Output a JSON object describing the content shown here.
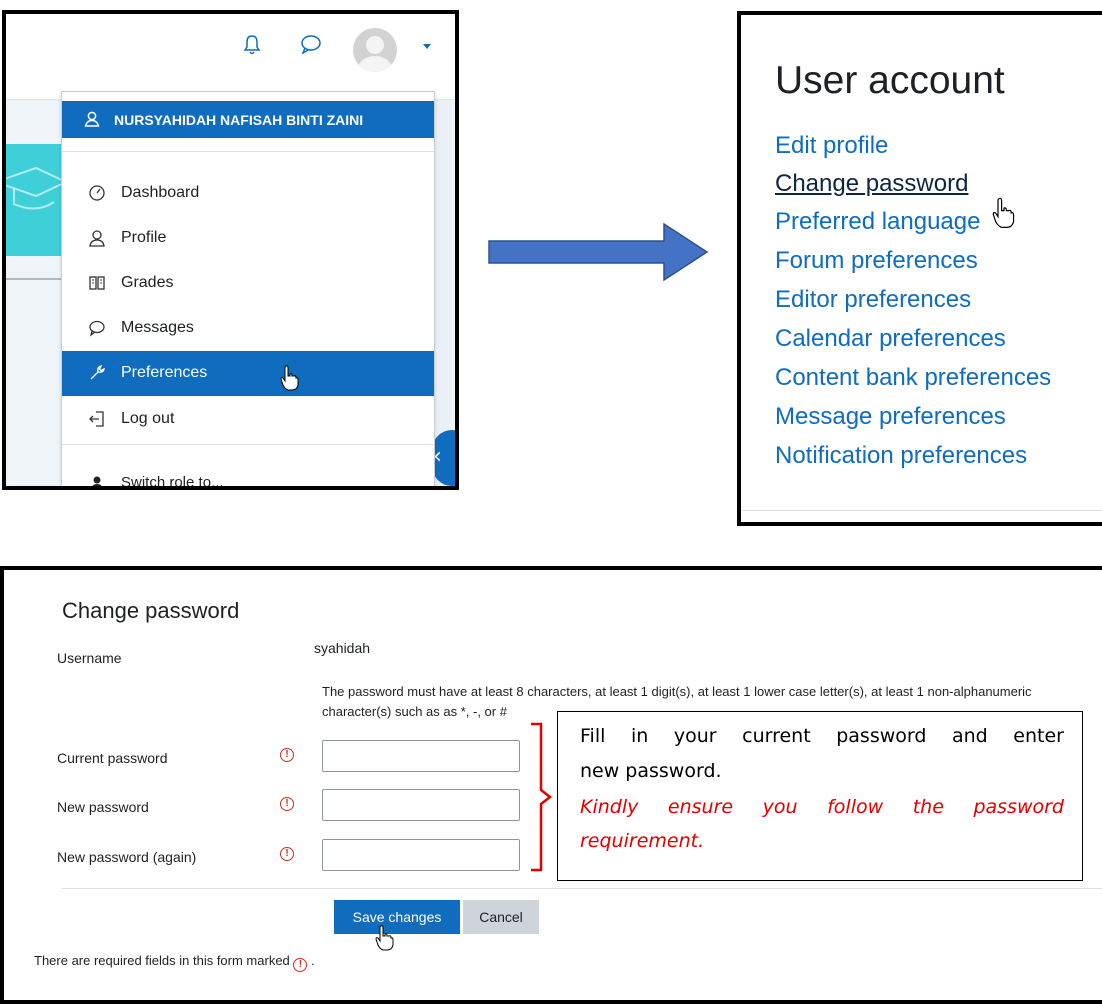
{
  "panel1": {
    "user_name": "NURSYAHIDAH NAFISAH BINTI ZAINI",
    "menu_items": [
      {
        "label": "Dashboard",
        "icon": "dashboard-icon"
      },
      {
        "label": "Profile",
        "icon": "user-icon"
      },
      {
        "label": "Grades",
        "icon": "grades-icon"
      },
      {
        "label": "Messages",
        "icon": "message-icon"
      },
      {
        "label": "Preferences",
        "icon": "wrench-icon",
        "active": true
      },
      {
        "label": "Log out",
        "icon": "logout-icon"
      },
      {
        "label": "Switch role to...",
        "icon": "role-icon"
      }
    ]
  },
  "panel2": {
    "title": "User account",
    "links": [
      "Edit profile",
      "Change password",
      "Preferred language",
      "Forum preferences",
      "Editor preferences",
      "Calendar preferences",
      "Content bank preferences",
      "Message preferences",
      "Notification preferences"
    ]
  },
  "panel3": {
    "title": "Change password",
    "username_label": "Username",
    "username_value": "syahidah",
    "password_rules": "The password must have at least 8 characters, at least 1 digit(s), at least 1 lower case letter(s), at least 1 non-alphanumeric character(s) such as as *, -, or #",
    "fields": [
      "Current password",
      "New password",
      "New password (again)"
    ],
    "save_label": "Save changes",
    "cancel_label": "Cancel",
    "required_note": "There are required fields in this form marked",
    "required_note_end": " .",
    "required_mark": "!"
  },
  "callout": {
    "line1": "Fill in your current password and enter",
    "line2": "new password.",
    "line3": "Kindly ensure you follow the password",
    "line4": "requirement."
  },
  "colors": {
    "primary": "#0f6cbf",
    "required": "#ca3120",
    "callout_emphasis": "#e00000",
    "teal": "#3fcfd8"
  }
}
